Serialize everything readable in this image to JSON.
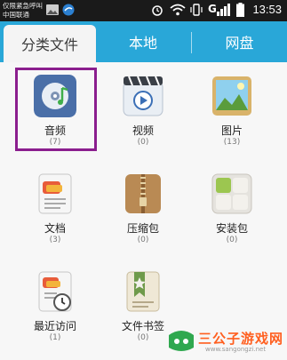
{
  "status_bar": {
    "carrier_line1": "仅限紧急呼叫",
    "carrier_line2": "中国联通",
    "network": "G",
    "time": "13:53"
  },
  "tabs": [
    {
      "label": "分类文件",
      "active": true
    },
    {
      "label": "本地",
      "active": false
    },
    {
      "label": "网盘",
      "active": false
    }
  ],
  "categories": [
    {
      "label": "音频",
      "count": "(7)",
      "icon": "audio-icon",
      "selected": true
    },
    {
      "label": "视频",
      "count": "(0)",
      "icon": "video-icon"
    },
    {
      "label": "图片",
      "count": "(13)",
      "icon": "image-icon"
    },
    {
      "label": "文档",
      "count": "(3)",
      "icon": "document-icon"
    },
    {
      "label": "压缩包",
      "count": "(0)",
      "icon": "archive-icon"
    },
    {
      "label": "安装包",
      "count": "(0)",
      "icon": "apk-icon"
    },
    {
      "label": "最近访问",
      "count": "(1)",
      "icon": "recent-icon"
    },
    {
      "label": "文件书签",
      "count": "(0)",
      "icon": "bookmark-icon"
    }
  ],
  "colors": {
    "tab_bar": "#29a7d8",
    "highlight": "#8b1e8e"
  },
  "watermark": {
    "brand": "三公子游戏网",
    "url": "www.sangongzi.net"
  }
}
